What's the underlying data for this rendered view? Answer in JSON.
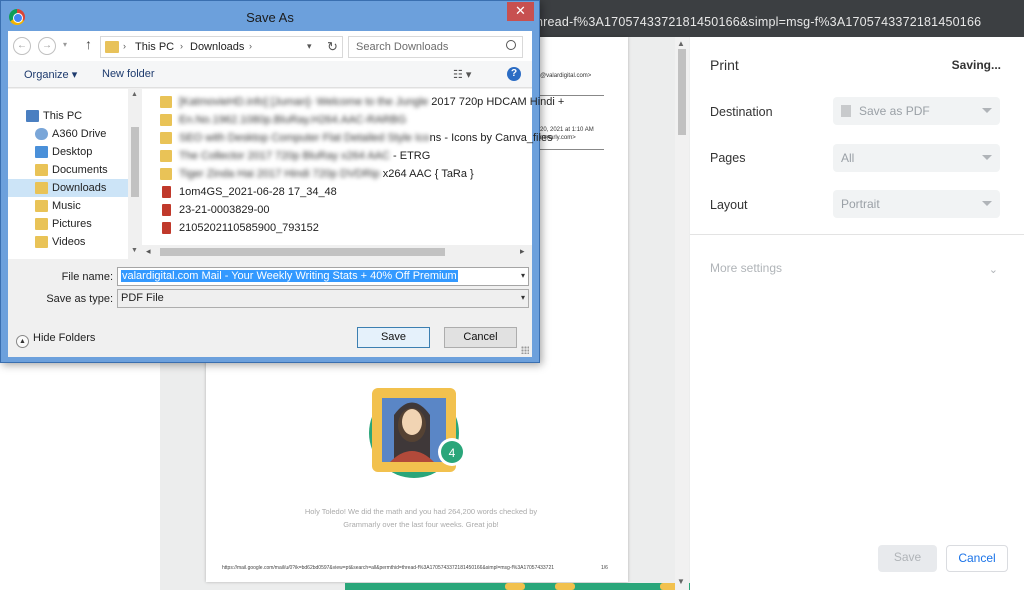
{
  "browser": {
    "url_fragment": "hread-f%3A1705743372181450166&simpl=msg-f%3A1705743372181450166"
  },
  "preview": {
    "header_email": "@valardigital.com>",
    "header_date": "20, 2021 at 1:10 AM",
    "header_sub": "mmarly.com>",
    "badge_number": "4",
    "message": "Holy Toledo! We did the math and you had 264,200 words checked by Grammarly over the last four weeks. Great job!",
    "footer_url": "https://mail.google.com/mail/u/0?ik=bd62bd0597&view=pt&search=all&permthid=thread-f%3A1705743372181450166&simpl=msg-f%3A17057433721",
    "page_number": "1/6"
  },
  "print_panel": {
    "title": "Print",
    "status": "Saving...",
    "destination_label": "Destination",
    "destination_value": "Save as PDF",
    "pages_label": "Pages",
    "pages_value": "All",
    "layout_label": "Layout",
    "layout_value": "Portrait",
    "more_settings": "More settings",
    "save_label": "Save",
    "cancel_label": "Cancel"
  },
  "dialog": {
    "title": "Save As",
    "close_glyph": "✕",
    "breadcrumb": [
      "This PC",
      "Downloads"
    ],
    "search_placeholder": "Search Downloads",
    "toolbar": {
      "organize": "Organize ▾",
      "new_folder": "New folder",
      "help": "?"
    },
    "nav_items": [
      {
        "label": "This PC",
        "icon": "computer-icon"
      },
      {
        "label": "A360 Drive",
        "icon": "cloud-drive-icon"
      },
      {
        "label": "Desktop",
        "icon": "folder-icon"
      },
      {
        "label": "Documents",
        "icon": "folder-icon"
      },
      {
        "label": "Downloads",
        "icon": "download-folder-icon",
        "selected": true
      },
      {
        "label": "Music",
        "icon": "folder-icon"
      },
      {
        "label": "Pictures",
        "icon": "folder-icon"
      },
      {
        "label": "Videos",
        "icon": "folder-icon"
      }
    ],
    "files": [
      {
        "blur_part": "[KatmovieHD.info] [Juman]- Welcome to the Jungle",
        "clear_part": " 2017 720p HDCAM Hindi +",
        "type": "folder"
      },
      {
        "blur_part": "En.No.1962.1080p.BluRay.H264.AAC-RARBG",
        "clear_part": "",
        "type": "folder"
      },
      {
        "blur_part": "SEO with Desktop Computer Flat Detailed Style Ico",
        "clear_part": "ns - Icons by Canva_files",
        "type": "folder"
      },
      {
        "blur_part": "The Collector 2017 720p BluRay x264 AAC",
        "clear_part": " - ETRG",
        "type": "folder"
      },
      {
        "blur_part": "Tiger Zinda Hai 2017 Hindi 720p DVDRip",
        "clear_part": " x264 AAC { TaRa }",
        "type": "folder"
      },
      {
        "blur_part": "",
        "clear_part": "1om4GS_2021-06-28 17_34_48",
        "type": "pdf"
      },
      {
        "blur_part": "",
        "clear_part": "23-21-0003829-00",
        "type": "pdf"
      },
      {
        "blur_part": "",
        "clear_part": "2105202110585900_793152",
        "type": "pdf"
      }
    ],
    "filename_label": "File name:",
    "filename_value": "valardigital.com Mail - Your Weekly Writing Stats + 40% Off Premium",
    "savetype_label": "Save as type:",
    "savetype_value": "PDF File",
    "hide_folders": "Hide Folders",
    "save_button": "Save",
    "cancel_button": "Cancel"
  }
}
